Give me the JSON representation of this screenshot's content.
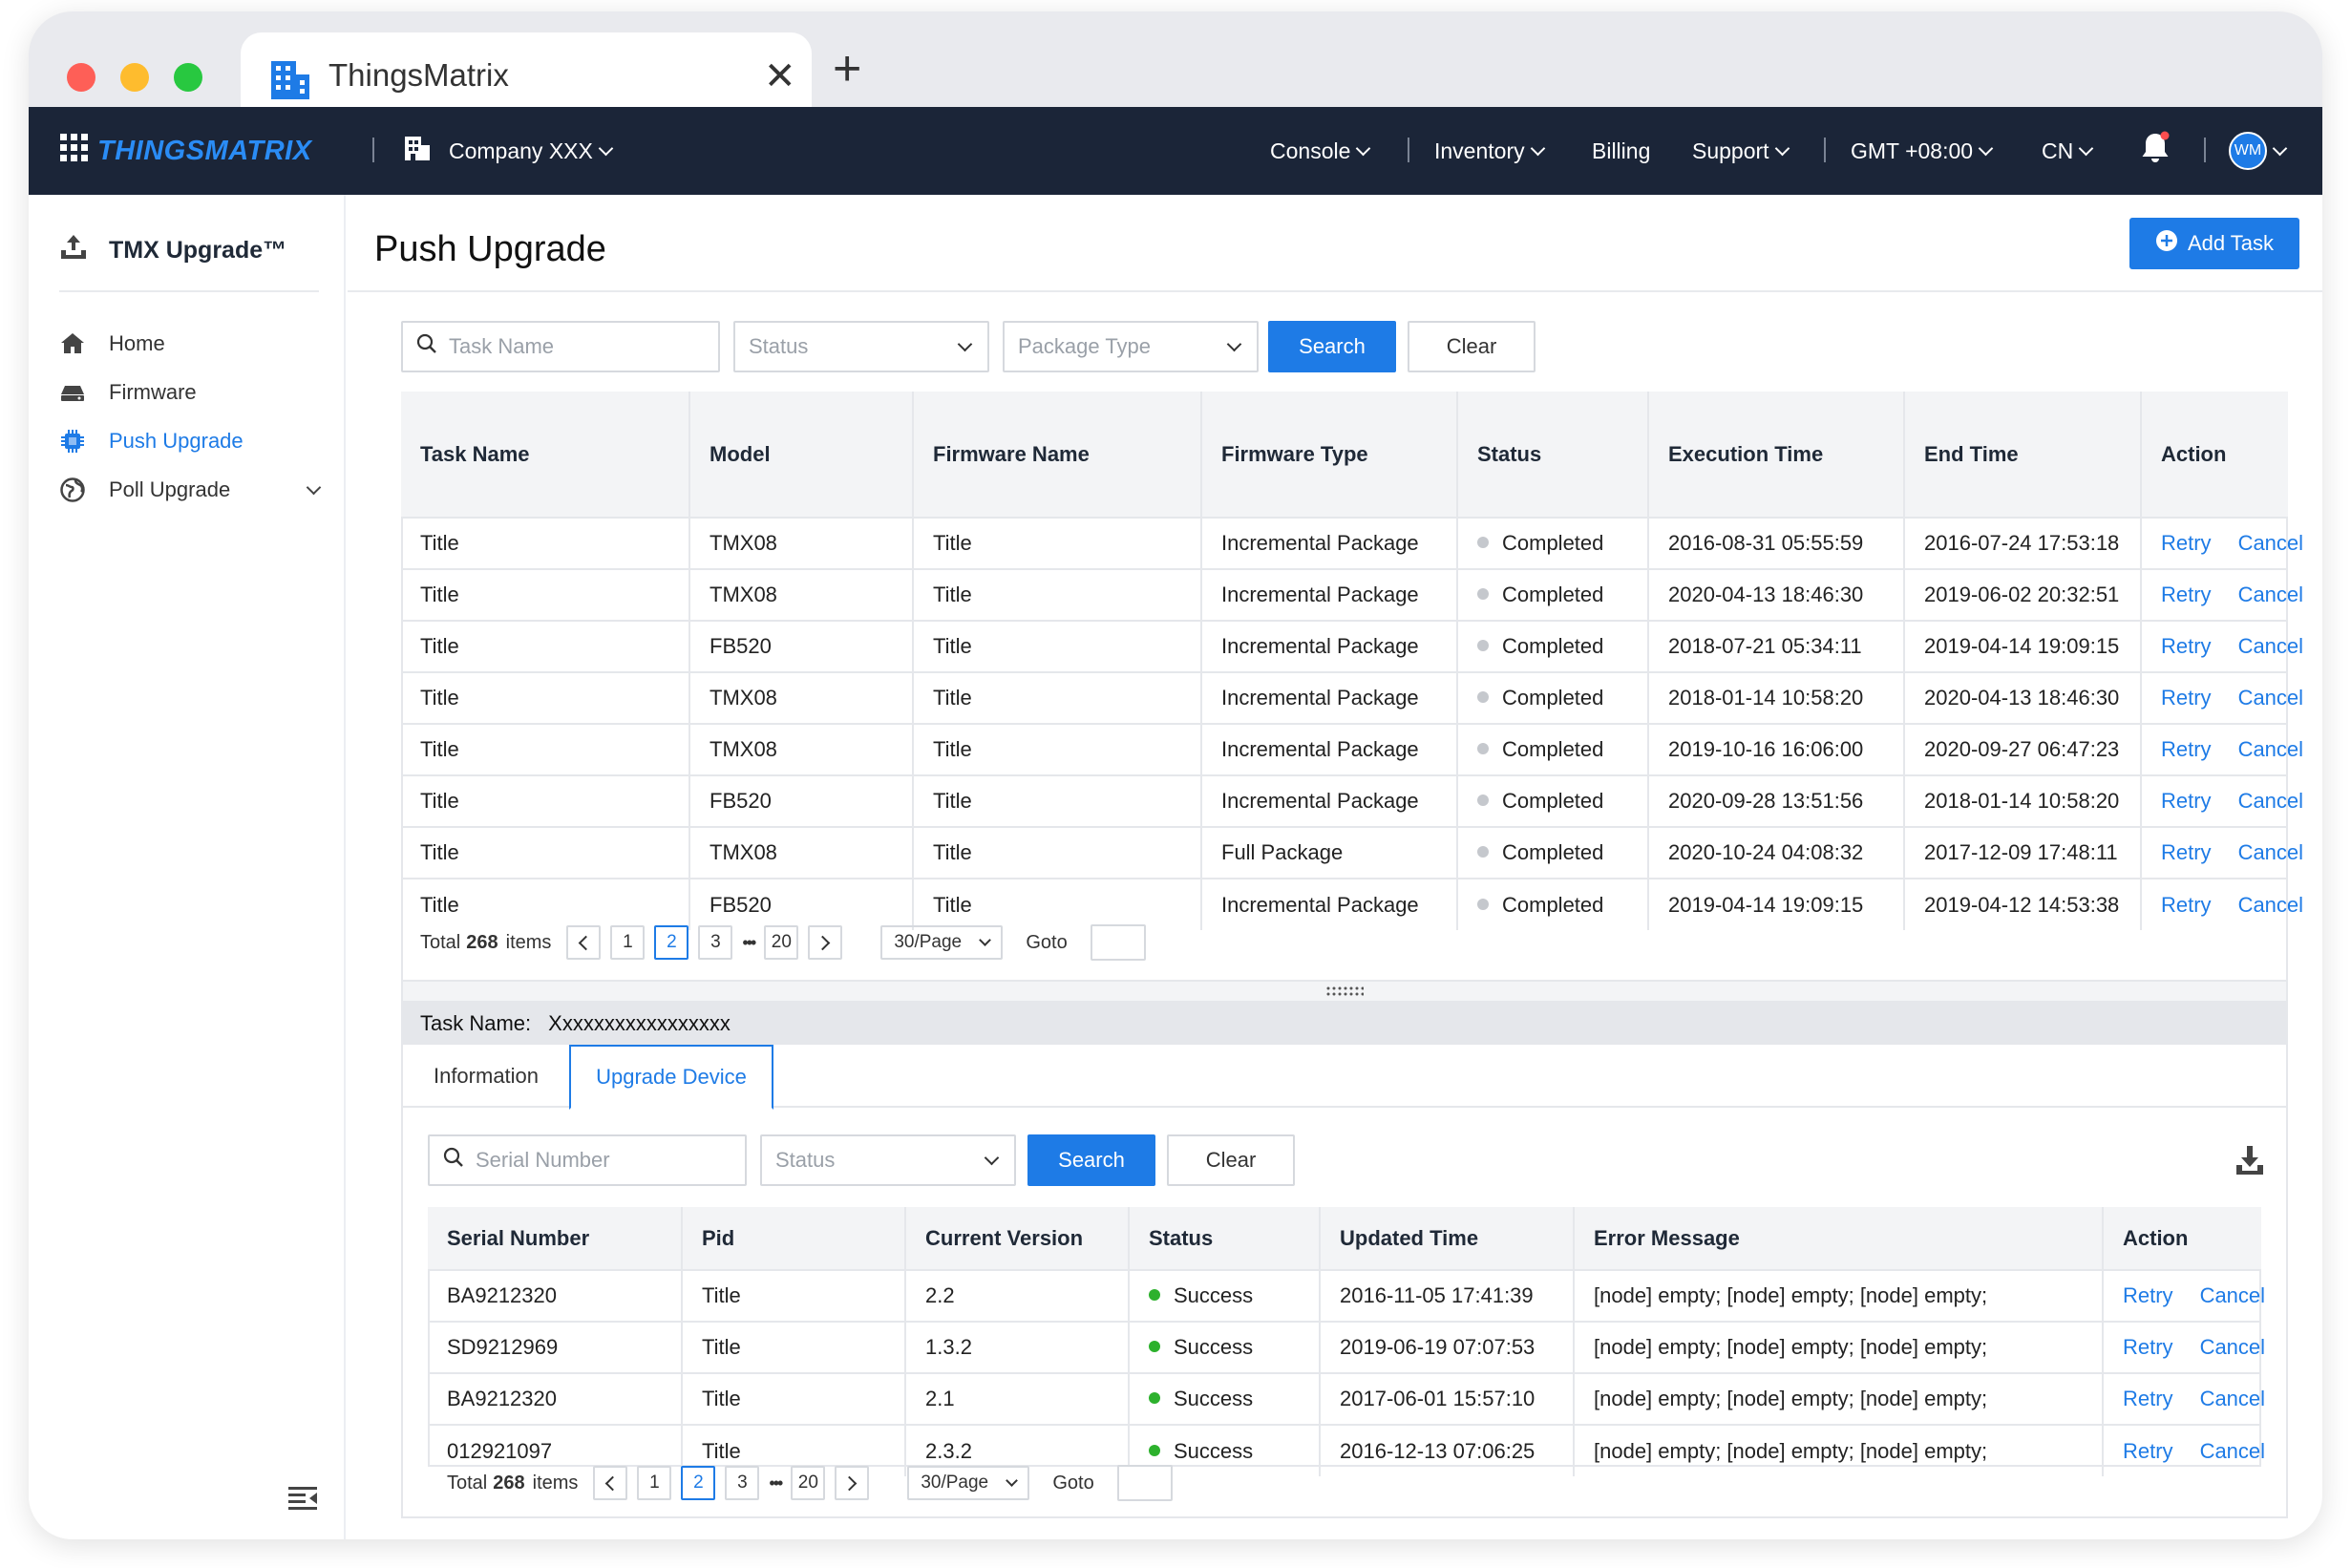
{
  "browser": {
    "tab_title": "ThingsMatrix",
    "close_glyph": "✕",
    "new_tab_glyph": "+",
    "traffic_colors": {
      "close": "#fe5f57",
      "minimize": "#febc2e",
      "zoom": "#28c840"
    }
  },
  "topnav": {
    "brand": "THINGSMATRIX",
    "company": "Company XXX",
    "menu": {
      "console": "Console",
      "inventory": "Inventory",
      "billing": "Billing",
      "support": "Support",
      "timezone": "GMT +08:00",
      "language": "CN"
    },
    "avatar": "WM"
  },
  "sidebar": {
    "title": "TMX Upgrade™",
    "items": [
      {
        "label": "Home",
        "icon": "home-icon"
      },
      {
        "label": "Firmware",
        "icon": "firmware-icon"
      },
      {
        "label": "Push Upgrade",
        "icon": "chip-icon",
        "active": true
      },
      {
        "label": "Poll Upgrade",
        "icon": "globe-icon"
      }
    ]
  },
  "page": {
    "title": "Push Upgrade",
    "add_task": "Add Task"
  },
  "filters": {
    "task_name_placeholder": "Task Name",
    "status_placeholder": "Status",
    "package_type_placeholder": "Package Type",
    "search": "Search",
    "clear": "Clear"
  },
  "tasks_table": {
    "columns": [
      "Task Name",
      "Model",
      "Firmware Name",
      "Firmware Type",
      "Status",
      "Execution Time",
      "End Time",
      "Action"
    ],
    "rows": [
      {
        "task": "Title",
        "model": "TMX08",
        "firmware": "Title",
        "type": "Incremental Package",
        "status": "Completed",
        "exec": "2016-08-31 05:55:59",
        "end": "2016-07-24 17:53:18"
      },
      {
        "task": "Title",
        "model": "TMX08",
        "firmware": "Title",
        "type": "Incremental Package",
        "status": "Completed",
        "exec": "2020-04-13 18:46:30",
        "end": "2019-06-02 20:32:51"
      },
      {
        "task": "Title",
        "model": "FB520",
        "firmware": "Title",
        "type": "Incremental Package",
        "status": "Completed",
        "exec": "2018-07-21 05:34:11",
        "end": "2019-04-14 19:09:15"
      },
      {
        "task": "Title",
        "model": "TMX08",
        "firmware": "Title",
        "type": "Incremental Package",
        "status": "Completed",
        "exec": "2018-01-14 10:58:20",
        "end": "2020-04-13 18:46:30"
      },
      {
        "task": "Title",
        "model": "TMX08",
        "firmware": "Title",
        "type": "Incremental Package",
        "status": "Completed",
        "exec": "2019-10-16 16:06:00",
        "end": "2020-09-27 06:47:23"
      },
      {
        "task": "Title",
        "model": "FB520",
        "firmware": "Title",
        "type": "Incremental Package",
        "status": "Completed",
        "exec": "2020-09-28 13:51:56",
        "end": "2018-01-14 10:58:20"
      },
      {
        "task": "Title",
        "model": "TMX08",
        "firmware": "Title",
        "type": "Full Package",
        "status": "Completed",
        "exec": "2020-10-24 04:08:32",
        "end": "2017-12-09 17:48:11"
      },
      {
        "task": "Title",
        "model": "FB520",
        "firmware": "Title",
        "type": "Incremental Package",
        "status": "Completed",
        "exec": "2019-04-14 19:09:15",
        "end": "2019-04-12 14:53:38"
      }
    ],
    "retry": "Retry",
    "cancel": "Cancel",
    "status_color": "#c5c8cd"
  },
  "pagination": {
    "total_prefix": "Total",
    "total": "268",
    "total_suffix": "items",
    "pages": [
      "1",
      "2",
      "3"
    ],
    "ellipsis": "•••",
    "last": "20",
    "current": "2",
    "page_size": "30/Page",
    "goto": "Goto"
  },
  "detail": {
    "task_label": "Task Name:",
    "task_value": "Xxxxxxxxxxxxxxxxx",
    "tabs": [
      "Information",
      "Upgrade Device"
    ],
    "active_tab": "Upgrade Device",
    "serial_placeholder": "Serial Number",
    "status_placeholder": "Status",
    "search": "Search",
    "clear": "Clear",
    "columns": [
      "Serial Number",
      "Pid",
      "Current Version",
      "Status",
      "Updated Time",
      "Error Message",
      "Action"
    ],
    "rows": [
      {
        "serial": "BA9212320",
        "pid": "Title",
        "version": "2.2",
        "status": "Success",
        "updated": "2016-11-05 17:41:39",
        "error": "[node] empty; [node] empty; [node] empty;"
      },
      {
        "serial": "SD9212969",
        "pid": "Title",
        "version": "1.3.2",
        "status": "Success",
        "updated": "2019-06-19 07:07:53",
        "error": "[node] empty; [node] empty; [node] empty;"
      },
      {
        "serial": "BA9212320",
        "pid": "Title",
        "version": "2.1",
        "status": "Success",
        "updated": "2017-06-01 15:57:10",
        "error": "[node] empty; [node] empty; [node] empty;"
      },
      {
        "serial": "012921097",
        "pid": "Title",
        "version": "2.3.2",
        "status": "Success",
        "updated": "2016-12-13 07:06:25",
        "error": "[node] empty; [node] empty; [node] empty;"
      }
    ],
    "success_color": "#2db12d"
  },
  "colors": {
    "primary": "#1e7be6",
    "nav_bg": "#1b2538",
    "notify": "#ff4d4f"
  }
}
